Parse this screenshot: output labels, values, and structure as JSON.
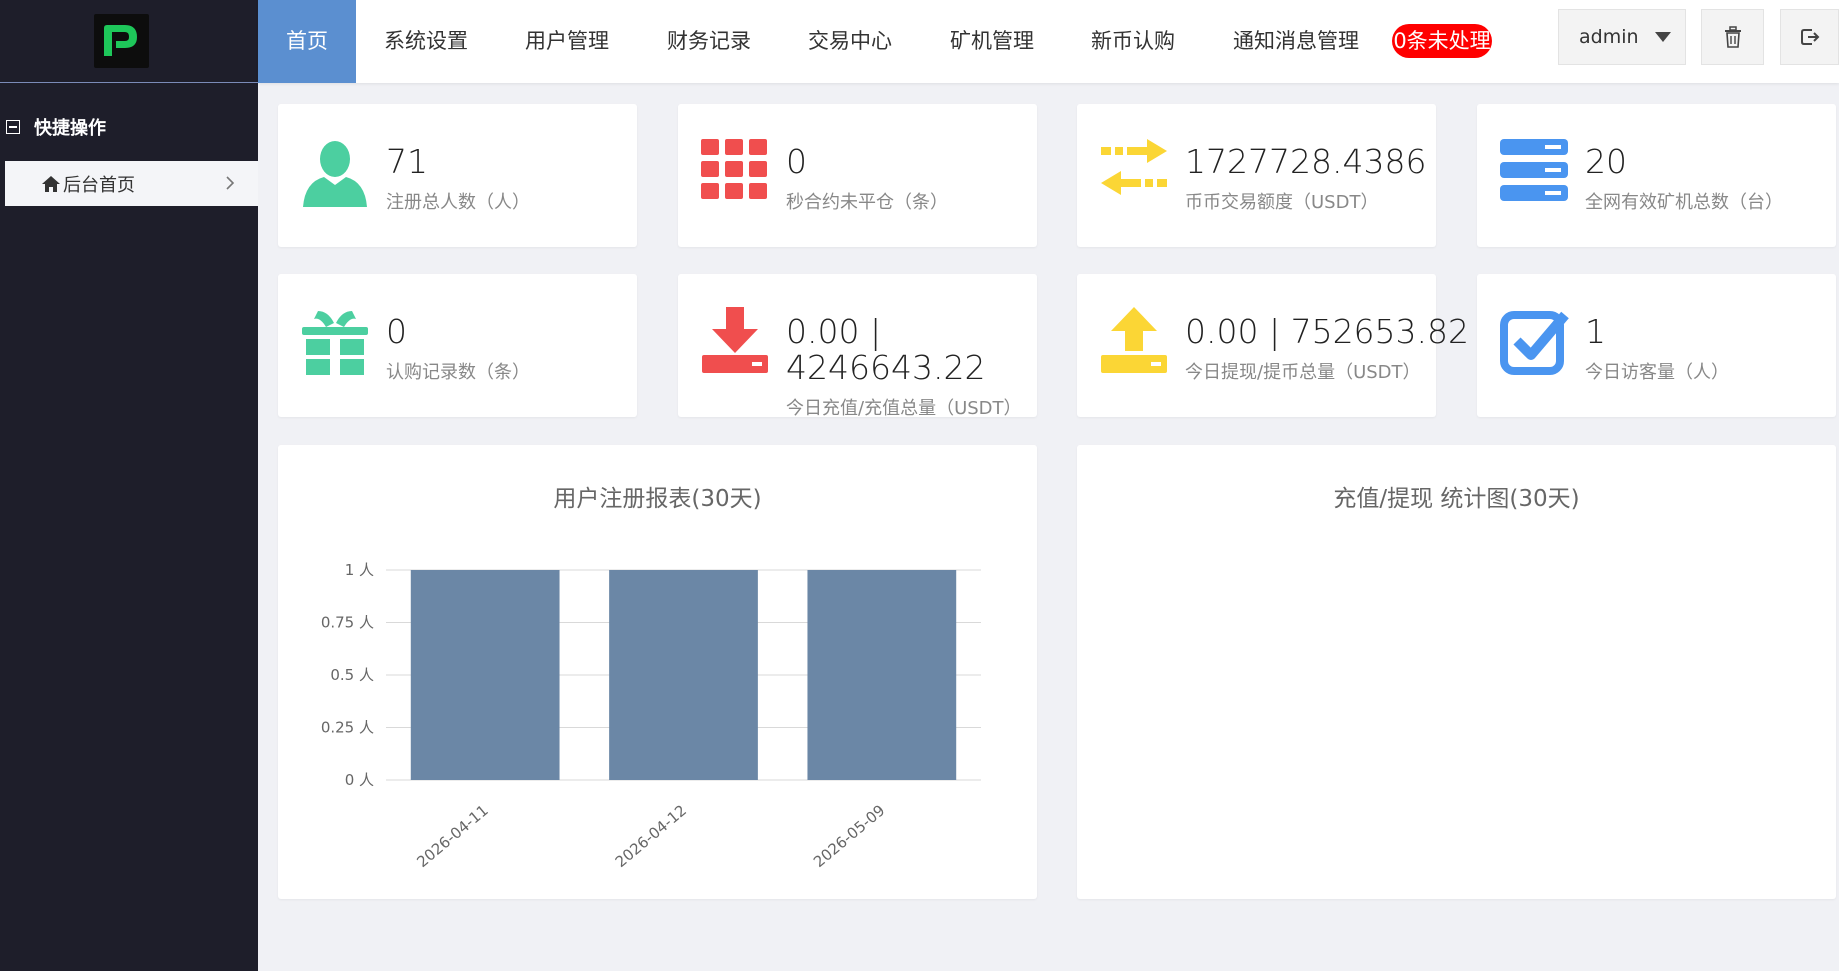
{
  "sidebar": {
    "section_title": "快捷操作",
    "items": [
      {
        "label": "后台首页"
      }
    ]
  },
  "nav": {
    "items": [
      {
        "label": "首页"
      },
      {
        "label": "系统设置"
      },
      {
        "label": "用户管理"
      },
      {
        "label": "财务记录"
      },
      {
        "label": "交易中心"
      },
      {
        "label": "矿机管理"
      },
      {
        "label": "新币认购"
      },
      {
        "label": "通知消息管理"
      }
    ],
    "badge": "0条未处理",
    "user": "admin"
  },
  "stats": [
    {
      "value": "71",
      "label": "注册总人数（人）",
      "icon": "user-icon",
      "color": "#4ccfa0"
    },
    {
      "value": "0",
      "label": "秒合约未平仓（条）",
      "icon": "grid-icon",
      "color": "#f04e4e"
    },
    {
      "value": "1727728.4386",
      "label": "币币交易额度（USDT）",
      "icon": "exchange-arrows-icon",
      "color": "#fbd635"
    },
    {
      "value": "20",
      "label": "全网有效矿机总数（台）",
      "icon": "server-icon",
      "color": "#4a95f0"
    },
    {
      "value": "0",
      "label": "认购记录数（条）",
      "icon": "gift-icon",
      "color": "#4ccfa0"
    },
    {
      "value": "0.00 | 4246643.22",
      "label": "今日充值/充值总量（USDT）",
      "icon": "download-icon",
      "color": "#f04e4e"
    },
    {
      "value": "0.00 | 752653.82",
      "label": "今日提现/提币总量（USDT）",
      "icon": "upload-icon",
      "color": "#fbd635"
    },
    {
      "value": "1",
      "label": "今日访客量（人）",
      "icon": "checkbox-icon",
      "color": "#4a95f0"
    }
  ],
  "panels": {
    "registration_title": "用户注册报表(30天)",
    "deposit_title": "充值/提现 统计图(30天)"
  },
  "chart_data": {
    "type": "bar",
    "title": "用户注册报表(30天)",
    "categories": [
      "2026-04-11",
      "2026-04-12",
      "2026-05-09"
    ],
    "values": [
      1,
      1,
      1
    ],
    "ylim": [
      0,
      1
    ],
    "yticks": [
      "0 人",
      "0.25 人",
      "0.5 人",
      "0.75 人",
      "1 人"
    ],
    "bar_color": "#6b87a6",
    "grid": true
  }
}
